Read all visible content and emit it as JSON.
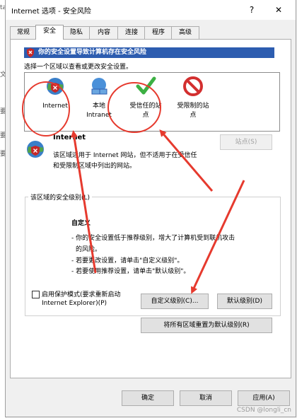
{
  "background": {
    "chars": [
      "ta",
      "文",
      "要",
      "要",
      "要"
    ]
  },
  "window": {
    "title": "Internet 选项 - 安全风险",
    "help_glyph": "?",
    "close_glyph": "✕"
  },
  "tabs": [
    "常规",
    "安全",
    "隐私",
    "内容",
    "连接",
    "程序",
    "高级"
  ],
  "warning_text": "你的安全设置导致计算机存在安全风险",
  "instruction": "选择一个区域以查看或更改安全设置。",
  "zones": [
    {
      "label": "Internet",
      "icon": "globe-warning-icon"
    },
    {
      "label": "本地\nIntranet",
      "icon": "intranet-icon"
    },
    {
      "label": "受信任的站\n点",
      "icon": "trusted-check-icon"
    },
    {
      "label": "受限制的站\n点",
      "icon": "restricted-icon"
    }
  ],
  "zone_detail": {
    "name": "Internet",
    "desc_line1": "该区域适用于 Internet 网站，但不适用于在受信任",
    "desc_line2": "和受限制区域中列出的网站。",
    "sites_button": "站点(S)"
  },
  "security_level": {
    "legend": "该区域的安全级别(L)",
    "level_name": "自定义",
    "lines": [
      "- 你的安全设置低于推荐级别，增大了计算机受到联机攻击",
      "的风险。",
      "- 若要更改设置，请单击\"自定义级别\"。",
      "- 若要使用推荐设置，请单击\"默认级别\"。"
    ],
    "protected_mode_line1": "启用保护模式(要求重新启动",
    "protected_mode_line2": "Internet Explorer)(P)",
    "custom_button": "自定义级别(C)...",
    "default_button": "默认级别(D)",
    "reset_all_button": "将所有区域重置为默认级别(R)"
  },
  "footer": {
    "ok": "确定",
    "cancel": "取消",
    "apply": "应用(A)"
  },
  "watermark": "CSDN @longli_cn",
  "colors": {
    "warning_bar": "#2d5db0",
    "annotation": "#e63a2e"
  }
}
